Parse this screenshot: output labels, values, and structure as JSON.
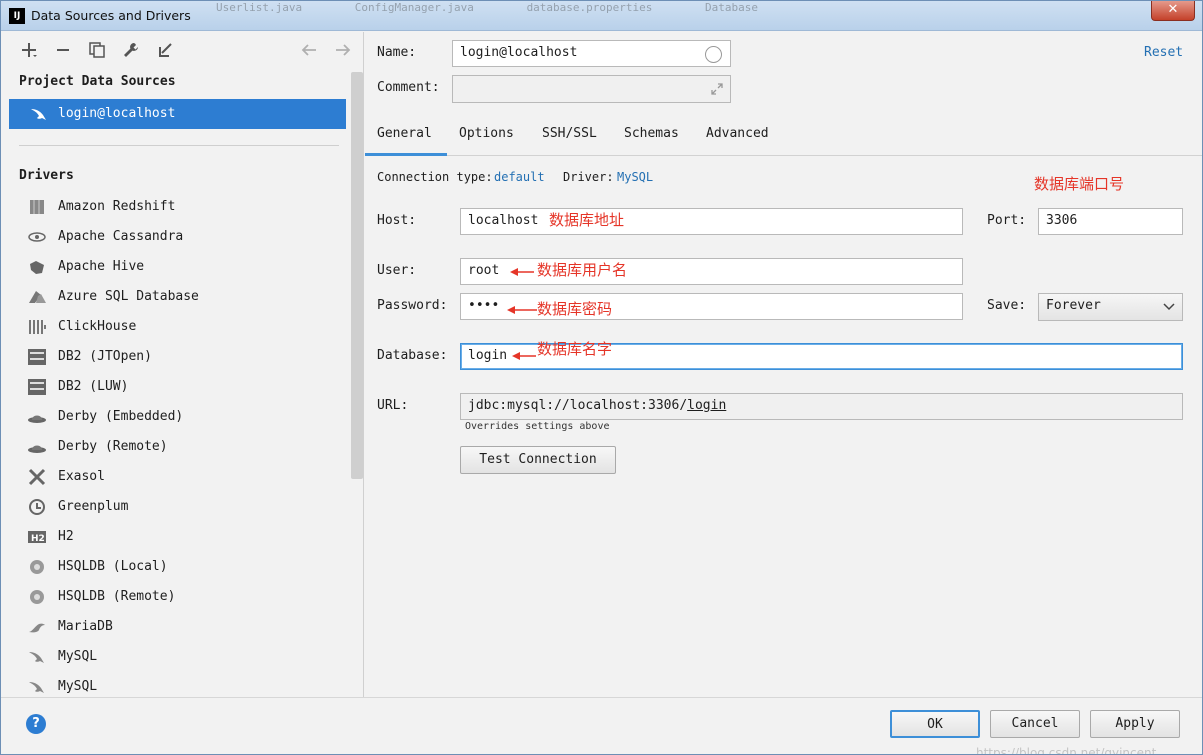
{
  "window": {
    "title": "Data Sources and Drivers",
    "app_icon_text": "IJ",
    "background_tabs": [
      "Userlist.java",
      "ConfigManager.java",
      "database.properties",
      "Database"
    ],
    "close_label": "✕"
  },
  "sidebar": {
    "project_section_label": "Project Data Sources",
    "data_sources": [
      {
        "label": "login@localhost",
        "icon": "mysql-dolphin-icon"
      }
    ],
    "drivers_section_label": "Drivers",
    "drivers": [
      {
        "label": "Amazon Redshift",
        "icon": "redshift-icon"
      },
      {
        "label": "Apache Cassandra",
        "icon": "cassandra-eye-icon"
      },
      {
        "label": "Apache Hive",
        "icon": "hive-icon"
      },
      {
        "label": "Azure SQL Database",
        "icon": "azure-icon"
      },
      {
        "label": "ClickHouse",
        "icon": "clickhouse-icon"
      },
      {
        "label": "DB2 (JTOpen)",
        "icon": "ibm-db2-icon"
      },
      {
        "label": "DB2 (LUW)",
        "icon": "ibm-db2-icon"
      },
      {
        "label": "Derby (Embedded)",
        "icon": "derby-hat-icon"
      },
      {
        "label": "Derby (Remote)",
        "icon": "derby-hat-icon"
      },
      {
        "label": "Exasol",
        "icon": "exasol-x-icon"
      },
      {
        "label": "Greenplum",
        "icon": "greenplum-icon"
      },
      {
        "label": "H2",
        "icon": "h2-icon"
      },
      {
        "label": "HSQLDB (Local)",
        "icon": "hsqldb-icon"
      },
      {
        "label": "HSQLDB (Remote)",
        "icon": "hsqldb-icon"
      },
      {
        "label": "MariaDB",
        "icon": "mariadb-seal-icon"
      },
      {
        "label": "MySQL",
        "icon": "mysql-dolphin-icon"
      },
      {
        "label": "MySQL",
        "icon": "mysql-dolphin-icon"
      }
    ],
    "toolbar_icons": [
      "add-icon",
      "remove-icon",
      "duplicate-icon",
      "wrench-icon",
      "import-icon",
      "back-arrow-icon",
      "forward-arrow-icon"
    ]
  },
  "form": {
    "name_label": "Name:",
    "name_value": "login@localhost",
    "comment_label": "Comment:",
    "comment_value": "",
    "reset_label": "Reset",
    "tabs": [
      {
        "label": "General",
        "active": true
      },
      {
        "label": "Options",
        "active": false
      },
      {
        "label": "SSH/SSL",
        "active": false
      },
      {
        "label": "Schemas",
        "active": false
      },
      {
        "label": "Advanced",
        "active": false
      }
    ],
    "connection_type_label": "Connection type:",
    "connection_type_value": "default",
    "driver_label": "Driver:",
    "driver_value": "MySQL",
    "host_label": "Host:",
    "host_value": "localhost",
    "port_label": "Port:",
    "port_value": "3306",
    "user_label": "User:",
    "user_value": "root",
    "password_label": "Password:",
    "password_value": "••••",
    "save_label": "Save:",
    "save_value": "Forever",
    "database_label": "Database:",
    "database_value": "login",
    "url_label": "URL:",
    "url_prefix": "jdbc:mysql://localhost:3306/",
    "url_db": "login",
    "url_note": "Overrides settings above",
    "test_connection_label": "Test Connection"
  },
  "annotations": {
    "port": "数据库端口号",
    "host": "数据库地址",
    "user": "数据库用户名",
    "password": "数据库密码",
    "database": "数据库名字",
    "color": "#e53528"
  },
  "footer": {
    "help_label": "?",
    "ok_label": "OK",
    "cancel_label": "Cancel",
    "apply_label": "Apply",
    "watermark": "https://blog.csdn.net/qyincent"
  },
  "colors": {
    "accent": "#2d7dd2",
    "link": "#2470b3",
    "selection": "#2d7dd2"
  }
}
